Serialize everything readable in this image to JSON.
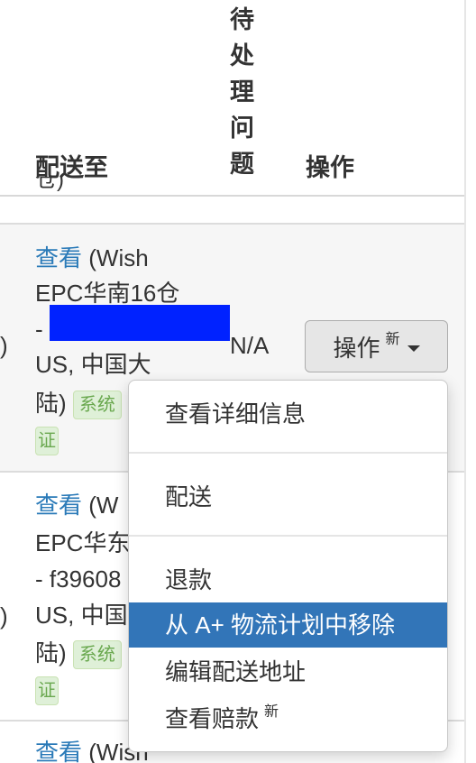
{
  "header": {
    "ship_to": "配送至",
    "pending_chars": [
      "待",
      "处",
      "理",
      "问",
      "题"
    ],
    "actions": "操作"
  },
  "clipped_prev": "仓)",
  "rows": [
    {
      "view_link": "查看",
      "line1_rest": " (Wish",
      "line2": "EPC华南16仓",
      "line3": "-",
      "line4": "US, 中国大",
      "line5": "陆)",
      "badge": "系统",
      "badge_cont": "证",
      "pending": "N/A",
      "left_paren": ")"
    },
    {
      "view_link": "查看",
      "line1_rest": " (W",
      "line2": "EPC华东",
      "line3": "- f39608",
      "line4": "US, 中国",
      "line5": "陆)",
      "badge": "系统",
      "badge_cont": "证",
      "left_paren": ")"
    },
    {
      "view_link": "查看",
      "line1_rest": " (Wish"
    }
  ],
  "action_button": {
    "label": "操作",
    "new_tag": "新"
  },
  "menu": {
    "items": [
      {
        "label": "查看详细信息"
      },
      {
        "label": "配送"
      },
      {
        "label": "退款"
      },
      {
        "label": "从 A+ 物流计划中移除"
      },
      {
        "label": "编辑配送地址"
      },
      {
        "label": "查看赔款",
        "new_tag": "新"
      }
    ]
  }
}
